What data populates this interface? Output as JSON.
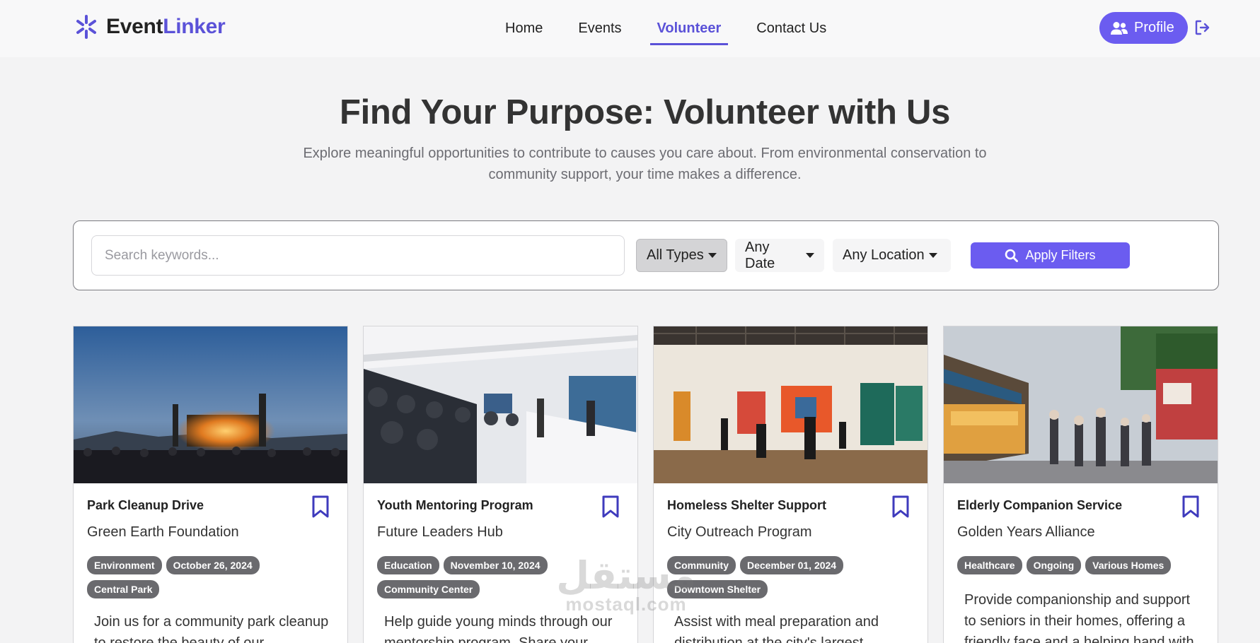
{
  "brand": {
    "part1": "Event",
    "part2": "Linker"
  },
  "nav": {
    "items": [
      "Home",
      "Events",
      "Volunteer",
      "Contact Us"
    ],
    "active": "Volunteer"
  },
  "header": {
    "profile_label": "Profile"
  },
  "hero": {
    "title": "Find Your Purpose: Volunteer with Us",
    "subtitle": "Explore meaningful opportunities to contribute to causes you care about. From environmental conservation to community support, your time makes a difference."
  },
  "filters": {
    "search_placeholder": "Search keywords...",
    "search_value": "",
    "type": "All Types",
    "date": "Any Date",
    "location": "Any Location",
    "apply_label": "Apply Filters"
  },
  "cards": [
    {
      "title": "Park Cleanup Drive",
      "org": "Green Earth Foundation",
      "tags": [
        "Environment",
        "October 26, 2024",
        "Central Park"
      ],
      "description": "Join us for a community park cleanup to restore the beauty of our"
    },
    {
      "title": "Youth Mentoring Program",
      "org": "Future Leaders Hub",
      "tags": [
        "Education",
        "November 10, 2024",
        "Community Center"
      ],
      "description": "Help guide young minds through our mentorship program. Share your"
    },
    {
      "title": "Homeless Shelter Support",
      "org": "City Outreach Program",
      "tags": [
        "Community",
        "December 01, 2024",
        "Downtown Shelter"
      ],
      "description": "Assist with meal preparation and distribution at the city's largest"
    },
    {
      "title": "Elderly Companion Service",
      "org": "Golden Years Alliance",
      "tags": [
        "Healthcare",
        "Ongoing",
        "Various Homes"
      ],
      "description": "Provide companionship and support to seniors in their homes, offering a friendly face and a helping hand with"
    }
  ],
  "watermark": {
    "arabic": "مستقل",
    "latin": "mostaql.com"
  },
  "colors": {
    "accent": "#6b5cf0",
    "tag_bg": "#6a6a6e",
    "bookmark": "#3f3bbd"
  }
}
